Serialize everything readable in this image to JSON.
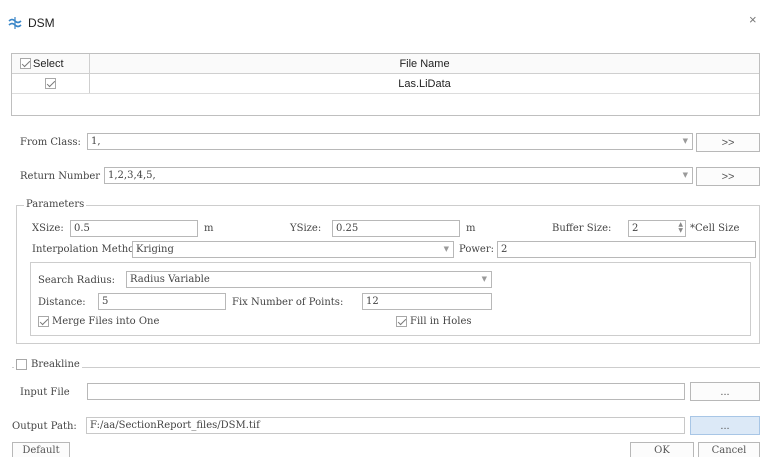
{
  "window": {
    "title": "DSM",
    "close_glyph": "×"
  },
  "table": {
    "header_select": "Select",
    "header_file": "File Name",
    "rows": [
      {
        "checked": true,
        "file": "Las.LiData"
      }
    ]
  },
  "from_class": {
    "label": "From Class:",
    "value": "1,",
    "button": ">>"
  },
  "return_number": {
    "label": "Return Number",
    "value": "1,2,3,4,5,",
    "button": ">>"
  },
  "parameters": {
    "legend": "Parameters",
    "xsize_label": "XSize:",
    "xsize": "0.5",
    "xsize_unit": "m",
    "ysize_label": "YSize:",
    "ysize": "0.25",
    "ysize_unit": "m",
    "buffer_label": "Buffer Size:",
    "buffer": "2",
    "buffer_unit": "*Cell Size",
    "interp_label": "Interpolation Method:",
    "interp": "Kriging",
    "power_label": "Power:",
    "power": "2",
    "search_label": "Search Radius:",
    "search": "Radius Variable",
    "distance_label": "Distance:",
    "distance": "5",
    "fixnum_label": "Fix Number of Points:",
    "fixnum": "12",
    "merge_label": "Merge Files into One",
    "merge_checked": true,
    "fill_label": "Fill in Holes",
    "fill_checked": true
  },
  "breakline": {
    "label": "Breakline",
    "checked": false,
    "input_label": "Input File",
    "input_value": "",
    "browse": "..."
  },
  "output": {
    "label": "Output Path:",
    "value": "F:/aa/SectionReport_files/DSM.tif",
    "browse": "..."
  },
  "footer": {
    "default": "Default",
    "ok": "OK",
    "cancel": "Cancel"
  },
  "colors": {
    "accent": "#3a86c8",
    "browse_active": "#dce9f7",
    "border": "#b8b8b8"
  }
}
